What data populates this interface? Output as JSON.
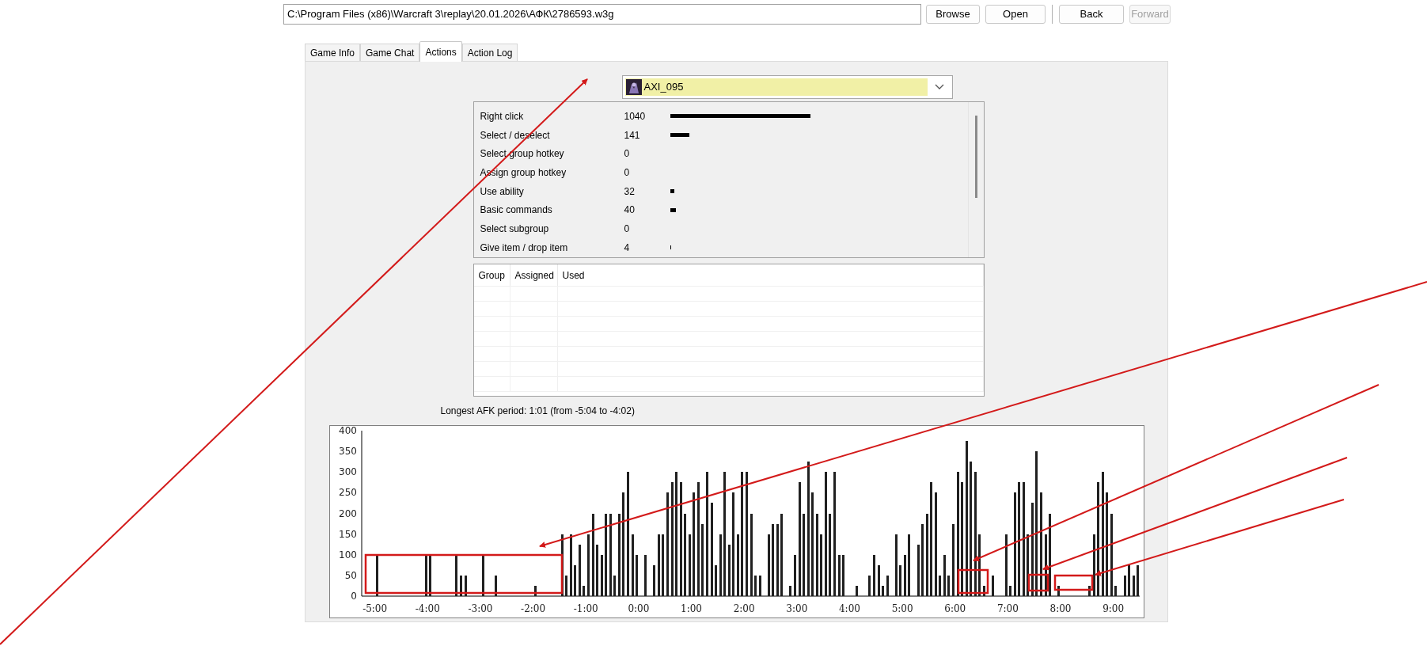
{
  "path_field": {
    "value": "C:\\Program Files (x86)\\Warcraft 3\\replay\\20.01.2026\\АФК\\2786593.w3g"
  },
  "buttons": [
    {
      "label": "Browse",
      "disabled": false
    },
    {
      "label": "Open",
      "disabled": false
    },
    {
      "label": "Back",
      "disabled": false
    },
    {
      "label": "Forward",
      "disabled": true
    }
  ],
  "tabs": [
    {
      "label": "Game Info",
      "selected": false
    },
    {
      "label": "Game Chat",
      "selected": false
    },
    {
      "label": "Actions",
      "selected": true
    },
    {
      "label": "Action Log",
      "selected": false
    }
  ],
  "player_select": {
    "value": "AXI_095"
  },
  "actions": [
    {
      "name": "Right click",
      "count": "1040"
    },
    {
      "name": "Select / deselect",
      "count": "141"
    },
    {
      "name": "Select group hotkey",
      "count": "0"
    },
    {
      "name": "Assign group hotkey",
      "count": "0"
    },
    {
      "name": "Use ability",
      "count": "32"
    },
    {
      "name": "Basic commands",
      "count": "40"
    },
    {
      "name": "Select subgroup",
      "count": "0"
    },
    {
      "name": "Give item / drop item",
      "count": "4"
    }
  ],
  "groups_table": {
    "columns": [
      "Group",
      "Assigned",
      "Used"
    ]
  },
  "afk_summary": "Longest AFK period: 1:01 (from -5:04 to -4:02)",
  "apm_chart": {
    "chart_data": {
      "type": "bar",
      "xlim": [
        -315,
        570
      ],
      "ylim": [
        0,
        400
      ],
      "xticks": [
        {
          "value": -300,
          "label": "-5:00"
        },
        {
          "value": -240,
          "label": "-4:00"
        },
        {
          "value": -180,
          "label": "-3:00"
        },
        {
          "value": -120,
          "label": "-2:00"
        },
        {
          "value": -60,
          "label": "-1:00"
        },
        {
          "value": 0,
          "label": "0:00"
        },
        {
          "value": 60,
          "label": "1:00"
        },
        {
          "value": 120,
          "label": "2:00"
        },
        {
          "value": 180,
          "label": "3:00"
        },
        {
          "value": 240,
          "label": "4:00"
        },
        {
          "value": 300,
          "label": "5:00"
        },
        {
          "value": 360,
          "label": "6:00"
        },
        {
          "value": 420,
          "label": "7:00"
        },
        {
          "value": 480,
          "label": "8:00"
        },
        {
          "value": 540,
          "label": "9:00"
        }
      ],
      "yticks": [
        0,
        50,
        100,
        150,
        200,
        250,
        300,
        350,
        400
      ],
      "x": [
        -297.5,
        -242.5,
        -237.5,
        -207.5,
        -202.5,
        -197.5,
        -177.5,
        -162.5,
        -117.5,
        -87.5,
        -82.5,
        -77.5,
        -72.5,
        -67.5,
        -62.5,
        -57.5,
        -52.5,
        -47.5,
        -42.5,
        -37.5,
        -32.5,
        -27.5,
        -22.5,
        -17.5,
        -12.5,
        -7.5,
        -2.5,
        7.5,
        17.5,
        22.5,
        27.5,
        32.5,
        37.5,
        42.5,
        47.5,
        52.5,
        57.5,
        62.5,
        67.5,
        72.5,
        77.5,
        82.5,
        87.5,
        92.5,
        97.5,
        102.5,
        107.5,
        112.5,
        117.5,
        122.5,
        127.5,
        132.5,
        137.5,
        147.5,
        152.5,
        157.5,
        162.5,
        172.5,
        177.5,
        182.5,
        187.5,
        192.5,
        197.5,
        202.5,
        207.5,
        212.5,
        217.5,
        222.5,
        227.5,
        232.5,
        247.5,
        262.5,
        267.5,
        272.5,
        277.5,
        282.5,
        292.5,
        297.5,
        302.5,
        307.5,
        317.5,
        322.5,
        327.5,
        332.5,
        337.5,
        342.5,
        347.5,
        352.5,
        357.5,
        362.5,
        367.5,
        372.5,
        377.5,
        382.5,
        387.5,
        392.5,
        402.5,
        417.5,
        422.5,
        427.5,
        432.5,
        437.5,
        442.5,
        447.5,
        452.5,
        457.5,
        462.5,
        467.5,
        477.5,
        512.5,
        517.5,
        522.5,
        527.5,
        532.5,
        537.5,
        542.5,
        552.5,
        557.5,
        562.5,
        567.5
      ],
      "values": [
        100,
        100,
        100,
        100,
        50,
        50,
        100,
        50,
        25,
        150,
        50,
        150,
        75,
        125,
        25,
        150,
        200,
        125,
        100,
        200,
        200,
        50,
        200,
        250,
        300,
        150,
        100,
        100,
        75,
        150,
        150,
        250,
        275,
        300,
        275,
        200,
        150,
        250,
        275,
        175,
        300,
        225,
        75,
        150,
        300,
        125,
        250,
        150,
        300,
        300,
        200,
        50,
        50,
        150,
        175,
        175,
        200,
        25,
        100,
        275,
        200,
        325,
        250,
        200,
        150,
        300,
        200,
        300,
        100,
        100,
        25,
        50,
        100,
        75,
        25,
        50,
        150,
        75,
        100,
        150,
        125,
        175,
        200,
        275,
        250,
        50,
        100,
        50,
        175,
        300,
        275,
        375,
        325,
        300,
        150,
        25,
        50,
        150,
        25,
        250,
        275,
        275,
        150,
        225,
        350,
        250,
        150,
        200,
        25,
        25,
        150,
        275,
        300,
        250,
        200,
        25,
        50,
        75,
        50,
        75
      ]
    }
  }
}
